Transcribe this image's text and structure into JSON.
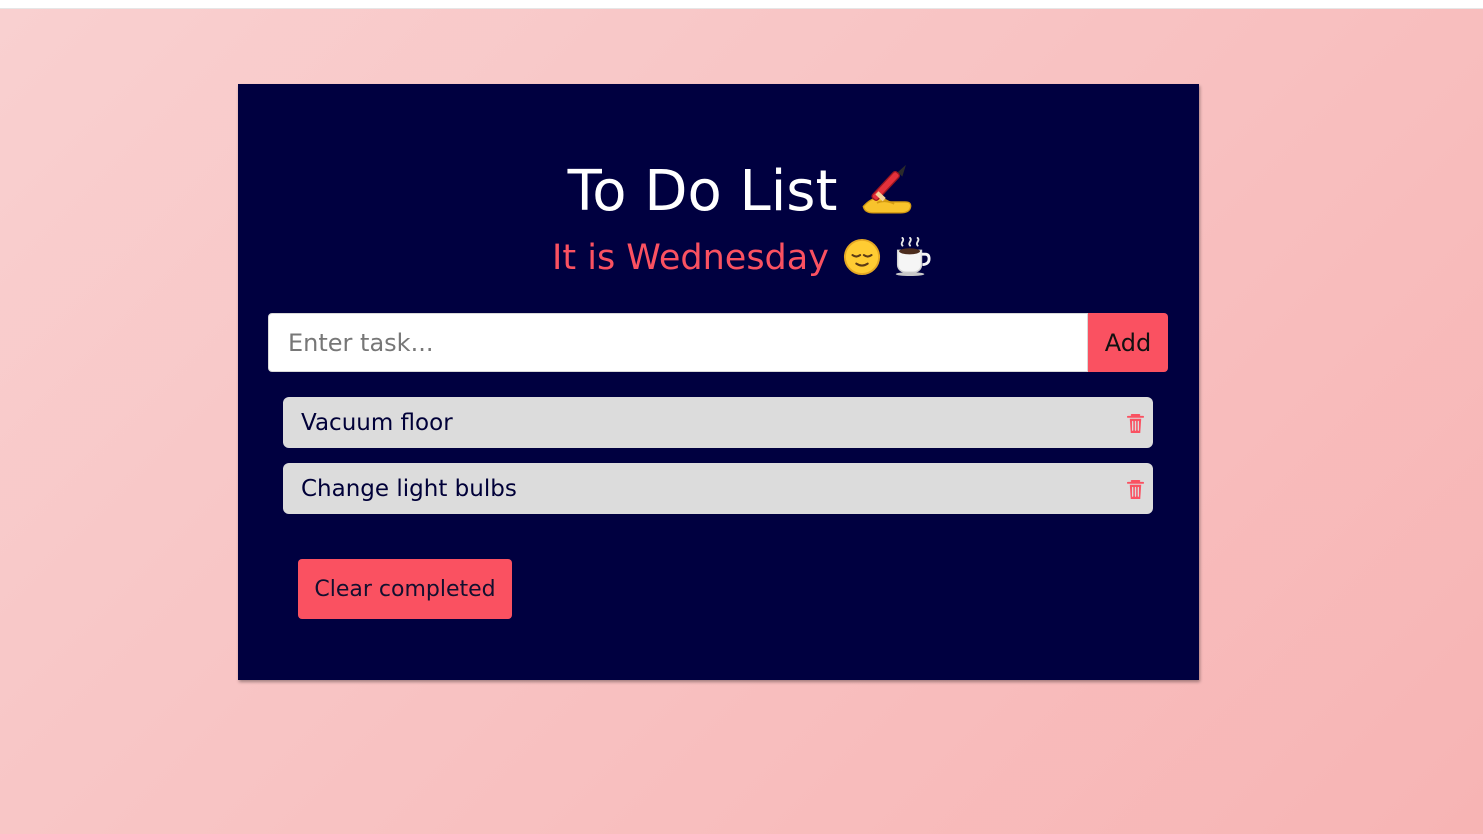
{
  "app": {
    "title": "To Do List",
    "title_icon": "writing-hand-icon",
    "subtitle": "It is Wednesday",
    "subtitle_icons": [
      "relieved-face-icon",
      "coffee-icon"
    ],
    "colors": {
      "page_background": "#f8c2c2",
      "card_background": "#000040",
      "accent": "#fa5161",
      "task_background": "#dcdcdc",
      "title_text": "#ffffff"
    }
  },
  "task_input": {
    "placeholder": "Enter task...",
    "value": ""
  },
  "add_button": {
    "label": "Add"
  },
  "tasks": [
    {
      "text": "Vacuum floor",
      "icon": "trash-icon"
    },
    {
      "text": "Change light bulbs",
      "icon": "trash-icon"
    }
  ],
  "clear_button": {
    "label": "Clear completed"
  }
}
